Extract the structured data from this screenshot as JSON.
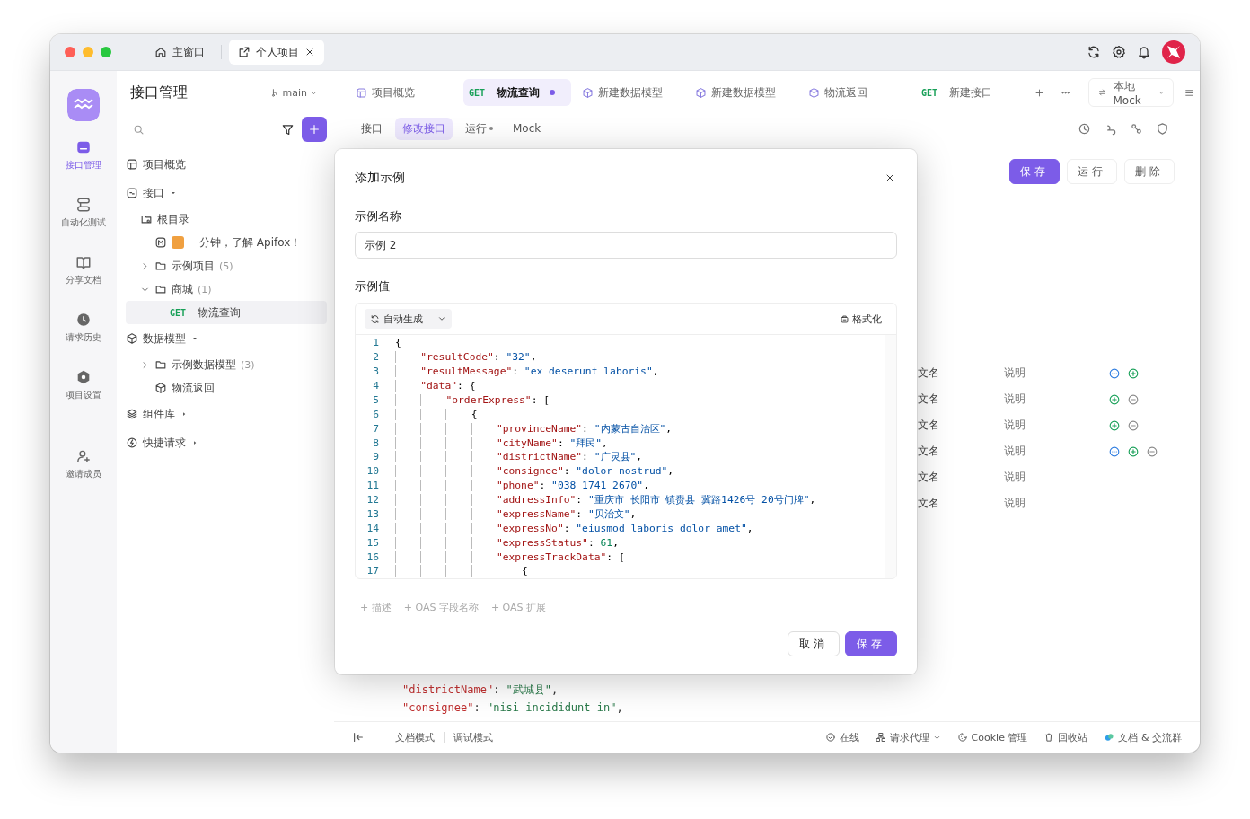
{
  "window": {
    "tabs": [
      {
        "label": "主窗口",
        "selected": false,
        "closable": false
      },
      {
        "label": "个人项目",
        "selected": true,
        "closable": true
      }
    ]
  },
  "nav_rail": {
    "items": [
      {
        "label": "接口管理",
        "selected": true
      },
      {
        "label": "自动化测试",
        "selected": false
      },
      {
        "label": "分享文档",
        "selected": false
      },
      {
        "label": "请求历史",
        "selected": false
      },
      {
        "label": "项目设置",
        "selected": false
      },
      {
        "label": "邀请成员",
        "selected": false
      }
    ]
  },
  "sidebar": {
    "title": "接口管理",
    "branch": "main",
    "tree": [
      {
        "kind": "overview",
        "label": "项目概览"
      },
      {
        "kind": "apis",
        "label": "接口",
        "expanded": true,
        "children": [
          {
            "kind": "root",
            "label": "根目录",
            "children": [
              {
                "kind": "doc",
                "label": "一分钟，了解 Apifox！"
              },
              {
                "kind": "folder",
                "label": "示例项目",
                "count": "(5)",
                "expanded": false
              },
              {
                "kind": "folder",
                "label": "商城",
                "count": "(1)",
                "expanded": true,
                "children": [
                  {
                    "kind": "request",
                    "method": "GET",
                    "label": "物流查询",
                    "selected": true
                  }
                ]
              }
            ]
          }
        ]
      },
      {
        "kind": "models",
        "label": "数据模型",
        "expanded": true,
        "children": [
          {
            "kind": "folder",
            "label": "示例数据模型",
            "count": "(3)",
            "expanded": false
          },
          {
            "kind": "model",
            "label": "物流返回"
          }
        ]
      },
      {
        "kind": "components",
        "label": "组件库",
        "expanded": false
      },
      {
        "kind": "quick",
        "label": "快捷请求",
        "expanded": false
      }
    ]
  },
  "header": {
    "tabs": [
      {
        "kind": "page",
        "label": "项目概览",
        "selected": false,
        "modified": false
      },
      {
        "kind": "request",
        "method": "GET",
        "label": "物流查询",
        "selected": true,
        "modified": true
      },
      {
        "kind": "model",
        "label": "新建数据模型",
        "selected": false,
        "modified": false
      },
      {
        "kind": "model",
        "label": "新建数据模型",
        "selected": false,
        "modified": false
      },
      {
        "kind": "model",
        "label": "物流返回",
        "selected": false,
        "modified": false
      },
      {
        "kind": "request",
        "method": "GET",
        "label": "新建接口",
        "selected": false,
        "modified": false
      }
    ],
    "environment": "本地 Mock"
  },
  "sub_tabs": [
    {
      "label": "接口",
      "selected": false,
      "modified": false
    },
    {
      "label": "修改接口",
      "selected": true,
      "modified": false
    },
    {
      "label": "运行",
      "selected": false,
      "modified": true
    },
    {
      "label": "Mock",
      "selected": false,
      "modified": false
    }
  ],
  "actions": [
    {
      "label": "保存",
      "kind": "primary"
    },
    {
      "label": "运行",
      "kind": "default"
    },
    {
      "label": "删除",
      "kind": "default"
    }
  ],
  "params_table": {
    "rows": [
      {
        "name": "文名",
        "description": "说明",
        "actions": [
          {
            "kind": "more"
          },
          {
            "kind": "add"
          }
        ]
      },
      {
        "name": "文名",
        "description": "说明",
        "actions": [
          {
            "kind": "add"
          },
          {
            "kind": "remove"
          }
        ]
      },
      {
        "name": "文名",
        "description": "说明",
        "actions": [
          {
            "kind": "add"
          },
          {
            "kind": "remove"
          }
        ]
      },
      {
        "name": "文名",
        "description": "说明",
        "actions": [
          {
            "kind": "more"
          },
          {
            "kind": "add"
          },
          {
            "kind": "remove"
          }
        ]
      },
      {
        "name": "文名",
        "description": "说明"
      },
      {
        "name": "文名",
        "description": "说明"
      }
    ]
  },
  "background_code": [
    "\"districtName\": \"武城县\",",
    "\"consignee\": \"nisi incididunt in\","
  ],
  "status_bar": {
    "left": [
      "文档模式",
      "调试模式"
    ],
    "right": [
      {
        "label": "在线",
        "dropdown": false
      },
      {
        "label": "请求代理",
        "dropdown": true
      },
      {
        "label": "Cookie 管理",
        "dropdown": false
      },
      {
        "label": "回收站",
        "dropdown": false
      },
      {
        "label": "文档 & 交流群",
        "dropdown": false
      }
    ]
  },
  "dialog": {
    "title": "添加示例",
    "name_label": "示例名称",
    "name_value": "示例 2",
    "value_label": "示例值",
    "generate_button": "自动生成",
    "format_button": "格式化",
    "code_lines": [
      {
        "n": "1",
        "text": "{"
      },
      {
        "n": "2",
        "text": "    \"resultCode\": \"32\","
      },
      {
        "n": "3",
        "text": "    \"resultMessage\": \"ex deserunt laboris\","
      },
      {
        "n": "4",
        "text": "    \"data\": {"
      },
      {
        "n": "5",
        "text": "        \"orderExpress\": ["
      },
      {
        "n": "6",
        "text": "            {"
      },
      {
        "n": "7",
        "text": "                \"provinceName\": \"内蒙古自治区\","
      },
      {
        "n": "8",
        "text": "                \"cityName\": \"拜民\","
      },
      {
        "n": "9",
        "text": "                \"districtName\": \"广灵县\","
      },
      {
        "n": "10",
        "text": "                \"consignee\": \"dolor nostrud\","
      },
      {
        "n": "11",
        "text": "                \"phone\": \"038 1741 2670\","
      },
      {
        "n": "12",
        "text": "                \"addressInfo\": \"重庆市 长阳市 镇赉县 冀路1426号 20号门牌\","
      },
      {
        "n": "13",
        "text": "                \"expressName\": \"贝治文\","
      },
      {
        "n": "14",
        "text": "                \"expressNo\": \"eiusmod laboris dolor amet\","
      },
      {
        "n": "15",
        "text": "                \"expressStatus\": 61,"
      },
      {
        "n": "16",
        "text": "                \"expressTrackData\": ["
      },
      {
        "n": "17",
        "text": "                    {"
      }
    ],
    "extras": [
      "+ 描述",
      "+ OAS 字段名称",
      "+ OAS 扩展"
    ],
    "buttons": [
      {
        "label": "取消",
        "kind": "default"
      },
      {
        "label": "保存",
        "kind": "primary"
      }
    ]
  }
}
